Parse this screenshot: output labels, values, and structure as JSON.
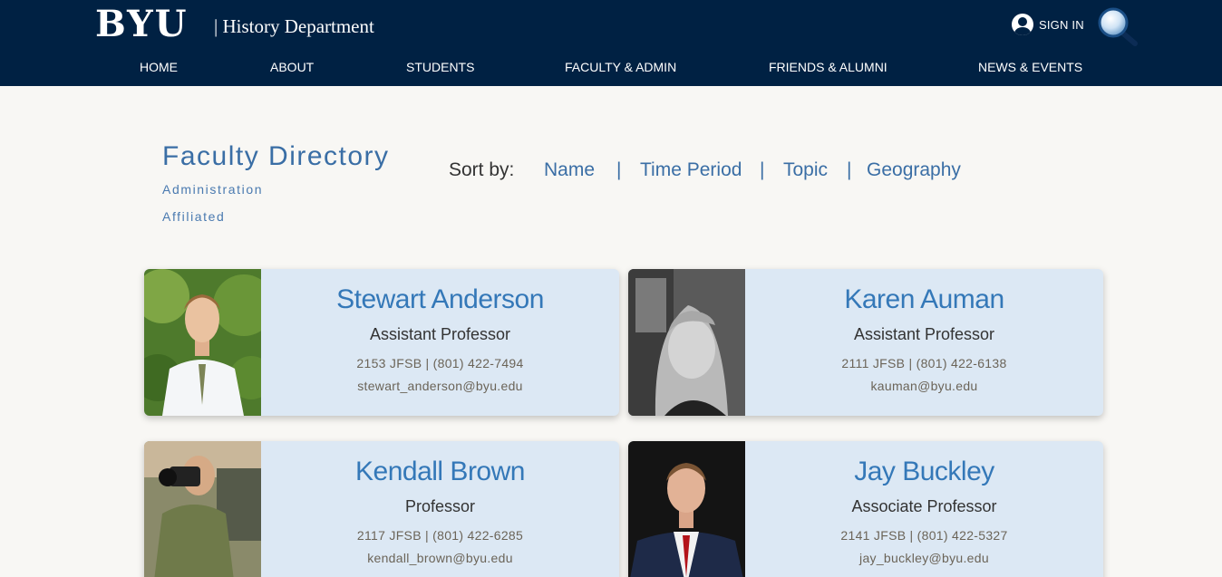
{
  "header": {
    "logo": "BYU",
    "department": "| History Department",
    "signin_label": "SIGN IN",
    "brand_color": "#002143"
  },
  "nav": [
    "HOME",
    "ABOUT",
    "STUDENTS",
    "FACULTY & ADMIN",
    "FRIENDS & ALUMNI",
    "NEWS & EVENTS"
  ],
  "directory": {
    "title": "Faculty Directory",
    "links": [
      "Administration",
      "Affiliated"
    ],
    "sort_label": "Sort by:",
    "sort_options": [
      "Name",
      "Time Period",
      "Topic",
      "Geography"
    ],
    "separator": "|"
  },
  "faculty": [
    {
      "name": "Stewart Anderson",
      "title": "Assistant Professor",
      "office": "2153 JFSB | (801) 422-7494",
      "email": "stewart_anderson@byu.edu"
    },
    {
      "name": "Karen Auman",
      "title": "Assistant Professor",
      "office": "2111 JFSB | (801) 422-6138",
      "email": "kauman@byu.edu"
    },
    {
      "name": "Kendall Brown",
      "title": "Professor",
      "office": "2117 JFSB | (801) 422-6285",
      "email": "kendall_brown@byu.edu"
    },
    {
      "name": "Jay Buckley",
      "title": "Associate Professor",
      "office": "2141 JFSB | (801) 422-5327",
      "email": "jay_buckley@byu.edu"
    }
  ]
}
